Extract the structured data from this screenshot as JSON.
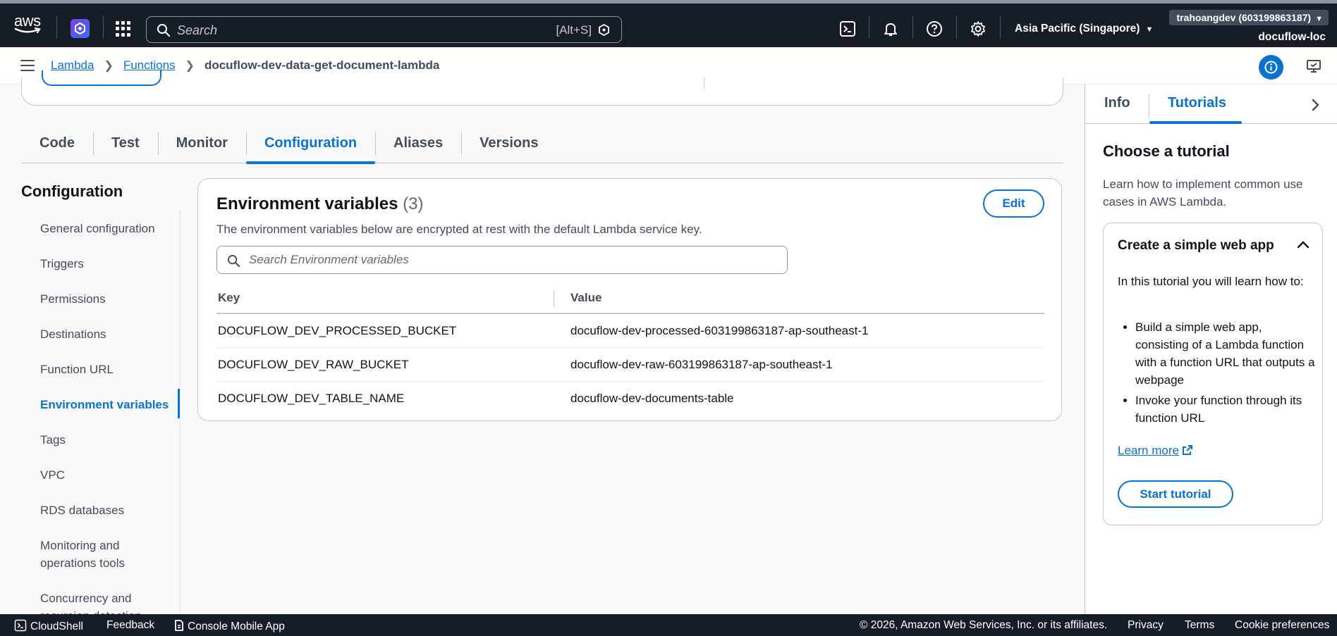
{
  "topnav": {
    "logo_text": "aws",
    "search_placeholder": "Search",
    "search_shortcut": "[Alt+S]",
    "region": "Asia Pacific (Singapore)",
    "account": "trahoangdev (603199863187)",
    "subaccount": "docuflow-loc",
    "icons": [
      "aws-logo",
      "amazon-q-icon",
      "apps-grid-icon",
      "search-icon",
      "cloudshell-icon",
      "bell-icon",
      "help-icon",
      "gear-icon"
    ]
  },
  "breadcrumb": {
    "items": [
      "Lambda",
      "Functions"
    ],
    "current": "docuflow-dev-data-get-document-lambda"
  },
  "tabs": [
    "Code",
    "Test",
    "Monitor",
    "Configuration",
    "Aliases",
    "Versions"
  ],
  "active_tab": "Configuration",
  "config": {
    "title": "Configuration",
    "nav": [
      "General configuration",
      "Triggers",
      "Permissions",
      "Destinations",
      "Function URL",
      "Environment variables",
      "Tags",
      "VPC",
      "RDS databases",
      "Monitoring and operations tools",
      "Concurrency and recursion detection"
    ],
    "active_nav": "Environment variables"
  },
  "env": {
    "title": "Environment variables",
    "count": "(3)",
    "description": "The environment variables below are encrypted at rest with the default Lambda service key.",
    "edit_label": "Edit",
    "search_placeholder": "Search Environment variables",
    "columns": [
      "Key",
      "Value"
    ],
    "rows": [
      {
        "key": "DOCUFLOW_DEV_PROCESSED_BUCKET",
        "value": "docuflow-dev-processed-603199863187-ap-southeast-1"
      },
      {
        "key": "DOCUFLOW_DEV_RAW_BUCKET",
        "value": "docuflow-dev-raw-603199863187-ap-southeast-1"
      },
      {
        "key": "DOCUFLOW_DEV_TABLE_NAME",
        "value": "docuflow-dev-documents-table"
      }
    ]
  },
  "help": {
    "tabs": [
      "Info",
      "Tutorials"
    ],
    "active_tab": "Tutorials",
    "title": "Choose a tutorial",
    "description": "Learn how to implement common use cases in AWS Lambda.",
    "tutorial": {
      "title": "Create a simple web app",
      "intro": "In this tutorial you will learn how to:",
      "bullets": [
        "Build a simple web app, consisting of a Lambda function with a function URL that outputs a webpage",
        "Invoke your function through its function URL"
      ],
      "learn_more": "Learn more",
      "start_label": "Start tutorial"
    }
  },
  "footer": {
    "cloudshell": "CloudShell",
    "feedback": "Feedback",
    "mobile_app": "Console Mobile App",
    "copyright": "© 2026, Amazon Web Services, Inc. or its affiliates.",
    "privacy": "Privacy",
    "terms": "Terms",
    "cookies": "Cookie preferences"
  },
  "colors": {
    "nav_bg": "#161d26",
    "accent": "#0972d3",
    "page_bg": "#f9f9fa"
  }
}
